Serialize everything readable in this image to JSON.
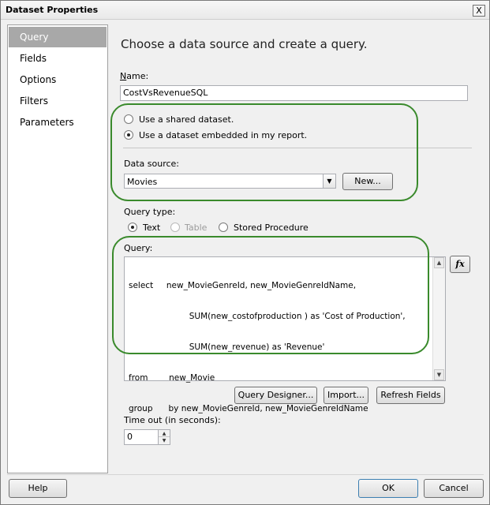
{
  "window": {
    "title": "Dataset Properties",
    "close_glyph": "X"
  },
  "sidebar": {
    "items": [
      {
        "label": "Query",
        "selected": true
      },
      {
        "label": "Fields"
      },
      {
        "label": "Options"
      },
      {
        "label": "Filters"
      },
      {
        "label": "Parameters"
      }
    ]
  },
  "main": {
    "heading": "Choose a data source and create a query.",
    "name_label": "Name:",
    "name_label_hotkey": "N",
    "name_value": "CostVsRevenueSQL",
    "shared_dataset_label": "Use a shared dataset.",
    "embedded_dataset_label": "Use a dataset embedded in my report.",
    "data_source_label": "Data source:",
    "data_source_value": "Movies",
    "new_button": "New...",
    "query_type_label": "Query type:",
    "query_type_text": "Text",
    "query_type_table": "Table",
    "query_type_sp": "Stored Procedure",
    "query_label": "Query:",
    "query_lines": [
      "select     new_MovieGenreId, new_MovieGenreIdName,",
      "                       SUM(new_costofproduction ) as 'Cost of Production',",
      "                       SUM(new_revenue) as 'Revenue'",
      "from        new_Movie",
      "group      by new_MovieGenreId, new_MovieGenreIdName"
    ],
    "fx_label": "fx",
    "query_designer_button": "Query Designer...",
    "import_button": "Import...",
    "refresh_fields_button": "Refresh Fields",
    "timeout_label": "Time out (in seconds):",
    "timeout_value": "0"
  },
  "footer": {
    "help_button": "Help",
    "ok_button": "OK",
    "cancel_button": "Cancel"
  },
  "colors": {
    "highlight_green": "#3a8a2c",
    "selected_nav": "#a8a8a8"
  }
}
